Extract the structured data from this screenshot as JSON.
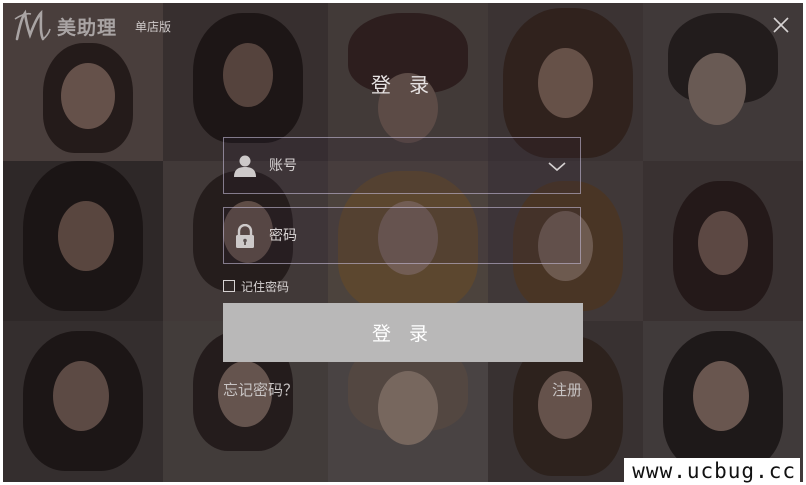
{
  "app": {
    "name": "美助理",
    "edition": "单店版",
    "logo_letter": "M"
  },
  "window": {
    "close_icon": "close-icon"
  },
  "login": {
    "title": "登 录",
    "account_placeholder": "账号",
    "password_placeholder": "密码",
    "remember_label": "记住密码",
    "remember_checked": false,
    "submit_label": "登 录",
    "forgot_label": "忘记密码？",
    "register_label": "注册"
  },
  "icons": {
    "account": "user-icon",
    "password": "lock-icon",
    "dropdown": "chevron-down-icon"
  },
  "colors": {
    "button_bg": "#b9b8b8",
    "field_border": "#d2c8e6",
    "text_light": "#e6e2e2"
  },
  "watermark": {
    "text": "www.ucbug.cc"
  }
}
